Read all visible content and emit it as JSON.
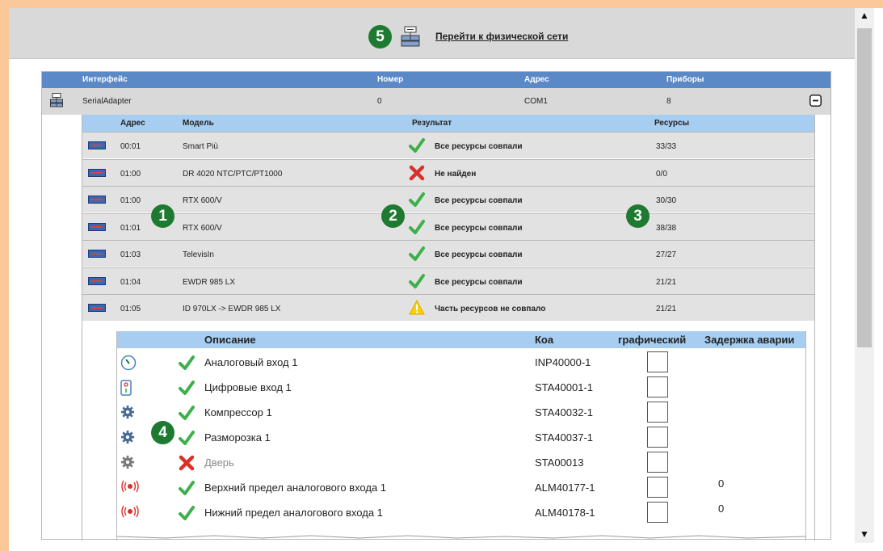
{
  "header": {
    "badge": "5",
    "goto_label": "Перейти к физической сети"
  },
  "interface_table": {
    "columns": [
      "Интерфейс",
      "Номер",
      "Адрес",
      "Приборы"
    ],
    "row": {
      "name": "SerialAdapter",
      "number": "0",
      "address": "COM1",
      "devices": "8"
    }
  },
  "devices_table": {
    "columns": [
      "Адрес",
      "Модель",
      "Результат",
      "Ресурсы"
    ],
    "rows": [
      {
        "address": "00:01",
        "model": "Smart Più",
        "result": "Все ресурсы совпали",
        "status": "ok",
        "resources": "33/33"
      },
      {
        "address": "01:00",
        "model": "DR 4020 NTC/PTC/PT1000",
        "result": "Не найден",
        "status": "error",
        "resources": "0/0"
      },
      {
        "address": "01:00",
        "model": "RTX 600/V",
        "result": "Все ресурсы совпали",
        "status": "ok",
        "resources": "30/30"
      },
      {
        "address": "01:01",
        "model": "RTX 600/V",
        "result": "Все ресурсы совпали",
        "status": "ok",
        "resources": "38/38"
      },
      {
        "address": "01:03",
        "model": "TelevisIn",
        "result": "Все ресурсы совпали",
        "status": "ok",
        "resources": "27/27"
      },
      {
        "address": "01:04",
        "model": "EWDR 985 LX",
        "result": "Все ресурсы совпали",
        "status": "ok",
        "resources": "21/21"
      },
      {
        "address": "01:05",
        "model": "ID 970LX -> EWDR 985 LX",
        "result": "Часть ресурсов не совпало",
        "status": "warning",
        "resources": "21/21"
      }
    ]
  },
  "resources_table": {
    "columns": [
      "Описание",
      "Коа",
      "графический",
      "Задержка аварии"
    ],
    "rows": [
      {
        "icon": "analog-input-icon",
        "status": "ok",
        "description": "Аналоговый вход 1",
        "code": "INP40000-1",
        "delay": ""
      },
      {
        "icon": "digital-input-icon",
        "status": "ok",
        "description": "Цифровые вход 1",
        "code": "STA40001-1",
        "delay": ""
      },
      {
        "icon": "gear-blue-icon",
        "status": "ok",
        "description": "Компрессор 1",
        "code": "STA40032-1",
        "delay": ""
      },
      {
        "icon": "gear-blue-icon",
        "status": "ok",
        "description": "Разморозка 1",
        "code": "STA40037-1",
        "delay": ""
      },
      {
        "icon": "gear-gray-icon",
        "status": "error",
        "description": "Дверь",
        "code": "STA00013",
        "delay": ""
      },
      {
        "icon": "alarm-icon",
        "status": "ok",
        "description": "Верхний предел аналогового входа 1",
        "code": "ALM40177-1",
        "delay": "0"
      },
      {
        "icon": "alarm-icon",
        "status": "ok",
        "description": "Нижний предел аналогового входа 1",
        "code": "ALM40178-1",
        "delay": "0"
      }
    ]
  },
  "callouts": [
    "1",
    "2",
    "3",
    "4"
  ],
  "colors": {
    "page_border": "#fbc89a",
    "header_blue": "#5b88c7",
    "light_blue": "#a7cdf0",
    "badge_green": "#1e7a30",
    "check_green": "#3db04b",
    "cross_red": "#d9302c",
    "warning_yellow": "#f7d200"
  }
}
